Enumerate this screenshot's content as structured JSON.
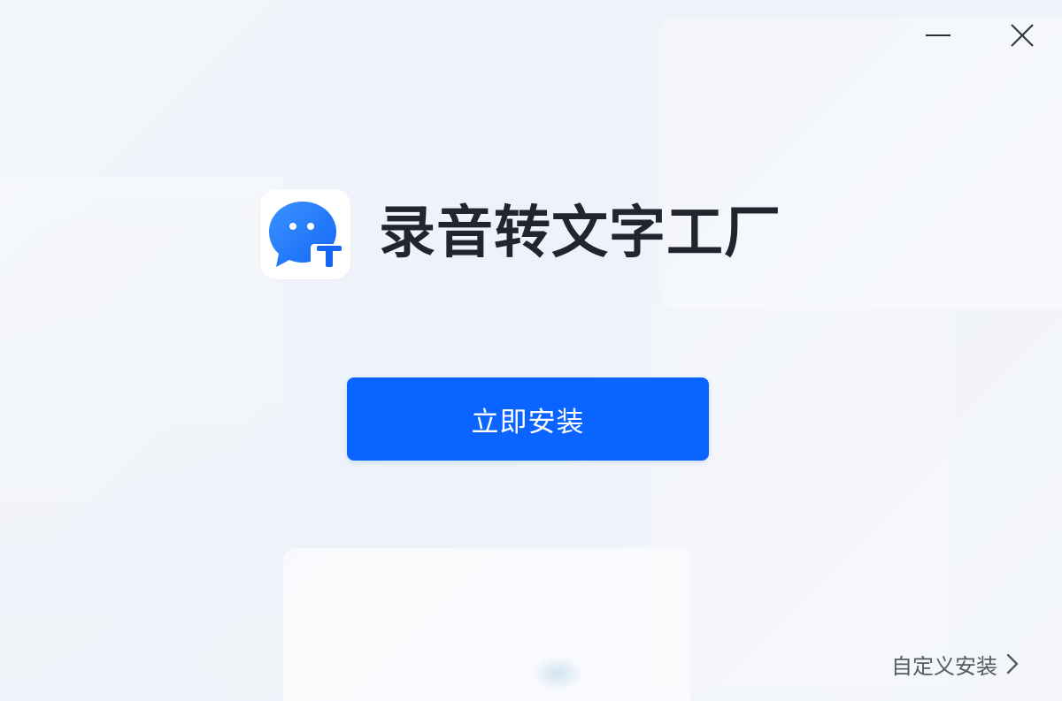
{
  "window": {
    "minimize_icon": "minimize-icon",
    "close_icon": "close-icon"
  },
  "app": {
    "title": "录音转文字工厂",
    "logo_icon": "chat-bubble-text-icon",
    "brand_color": "#1f7bff"
  },
  "actions": {
    "install_label": "立即安装",
    "install_color": "#0a64ff",
    "custom_install_label": "自定义安装",
    "custom_install_icon": "chevron-right-icon"
  }
}
